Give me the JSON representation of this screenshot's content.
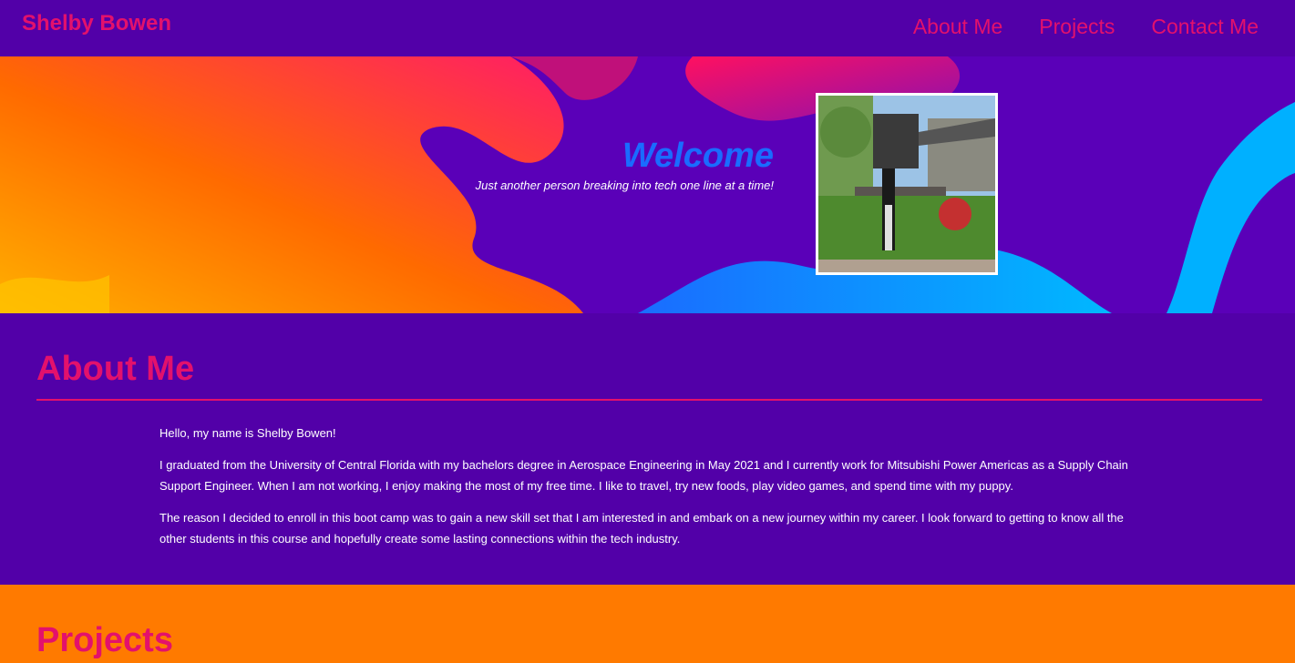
{
  "header": {
    "brand": "Shelby Bowen",
    "nav": [
      "About Me",
      "Projects",
      "Contact Me"
    ]
  },
  "hero": {
    "title": "Welcome",
    "subtitle": "Just another person breaking into tech one line at a time!",
    "photo_alt": "Graduation photo in front of statue"
  },
  "about": {
    "heading": "About Me",
    "paragraphs": [
      "Hello, my name is Shelby Bowen!",
      "I graduated from the University of Central Florida with my bachelors degree in Aerospace Engineering in May 2021 and I currently work for Mitsubishi Power Americas as a Supply Chain Support Engineer. When I am not working, I enjoy making the most of my free time. I like to travel, try new foods, play video games, and spend time with my puppy.",
      "The reason I decided to enroll in this boot camp was to gain a new skill set that I am interested in and embark on a new journey within my career. I look forward to getting to know all the other students in this course and hopefully create some lasting connections within the tech industry."
    ]
  },
  "projects": {
    "heading": "Projects"
  },
  "colors": {
    "primary_bg": "#5200a8",
    "accent": "#e3116c",
    "hero_title": "#1a6cff",
    "projects_bg": "#ff7a00"
  }
}
